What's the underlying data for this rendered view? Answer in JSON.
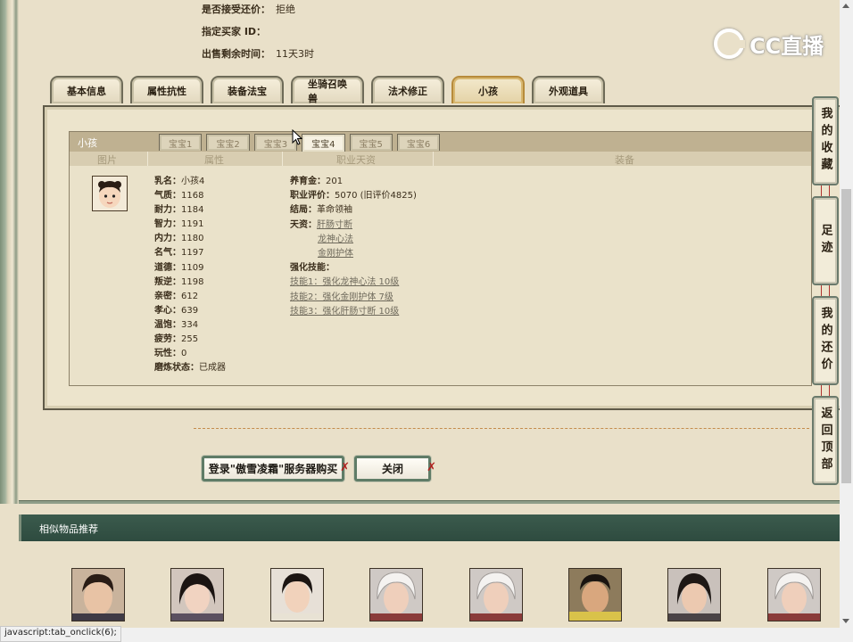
{
  "top_info": [
    {
      "key": "是否接受还价：",
      "value": "拒绝"
    },
    {
      "key": "指定买家 ID：",
      "value": ""
    },
    {
      "key": "出售剩余时间：",
      "value": "11天3时"
    }
  ],
  "logo_text": "CC直播",
  "main_tabs": [
    "基本信息",
    "属性抗性",
    "装备法宝",
    "坐骑召唤兽",
    "法术修正",
    "小孩",
    "外观道具"
  ],
  "main_tab_active": "小孩",
  "subpanel": {
    "title": "小孩",
    "tabs": [
      "宝宝1",
      "宝宝2",
      "宝宝3",
      "宝宝4",
      "宝宝5",
      "宝宝6"
    ],
    "active_tab": "宝宝4",
    "columns": [
      "图片",
      "属性",
      "职业天资",
      "装备"
    ]
  },
  "child_attrs": [
    {
      "k": "乳名：",
      "v": "小孩4"
    },
    {
      "k": "气质：",
      "v": "1168"
    },
    {
      "k": "耐力：",
      "v": "1184"
    },
    {
      "k": "智力：",
      "v": "1191"
    },
    {
      "k": "内力：",
      "v": "1180"
    },
    {
      "k": "名气：",
      "v": "1197"
    },
    {
      "k": "道德：",
      "v": "1109"
    },
    {
      "k": "叛逆：",
      "v": "1198"
    },
    {
      "k": "亲密：",
      "v": "612"
    },
    {
      "k": "孝心：",
      "v": "639"
    },
    {
      "k": "温饱：",
      "v": "334"
    },
    {
      "k": "疲劳：",
      "v": "255"
    },
    {
      "k": "玩性：",
      "v": "0"
    },
    {
      "k": "磨炼状态：",
      "v": "已成器"
    }
  ],
  "profession": {
    "fee_key": "养育金：",
    "fee_val": "201",
    "eval_key": "职业评价：",
    "eval_val": "5070 (旧评价4825)",
    "ending_key": "结局：",
    "ending_val": "革命领袖",
    "talent_key": "天资：",
    "talents": [
      "肝肠寸断",
      "龙神心法",
      "金刚护体"
    ],
    "skill_key": "强化技能：",
    "skills": [
      "技能1：强化龙神心法 10级",
      "技能2：强化金刚护体 7级",
      "技能3：强化肝肠寸断 10级"
    ]
  },
  "buttons": {
    "buy": "登录\"傲雪凌霜\"服务器购买",
    "close": "关闭"
  },
  "similar": {
    "title": "相似物品推荐"
  },
  "side_buttons": [
    "我的收藏",
    "足迹",
    "我的还价",
    "返回顶部"
  ],
  "status_text": "javascript:tab_onclick(6);"
}
